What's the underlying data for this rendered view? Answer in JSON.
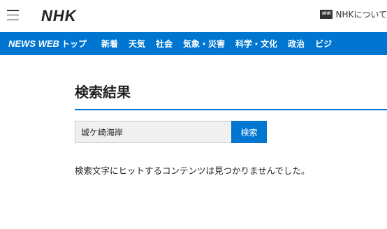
{
  "header": {
    "logo": "NHK",
    "menu_icon": "hamburger-menu-icon",
    "about_badge": "NHK",
    "about_label": "NHKについて"
  },
  "nav": {
    "brand": "NEWS WEB",
    "items": [
      "トップ",
      "新着",
      "天気",
      "社会",
      "気象・災害",
      "科学・文化",
      "政治",
      "ビジ"
    ]
  },
  "main": {
    "title": "検索結果",
    "search": {
      "value": "城ケ崎海岸",
      "button_label": "検索"
    },
    "message": "検索文字にヒットするコンテンツは見つかりませんでした。"
  },
  "colors": {
    "accent": "#0076d1"
  }
}
